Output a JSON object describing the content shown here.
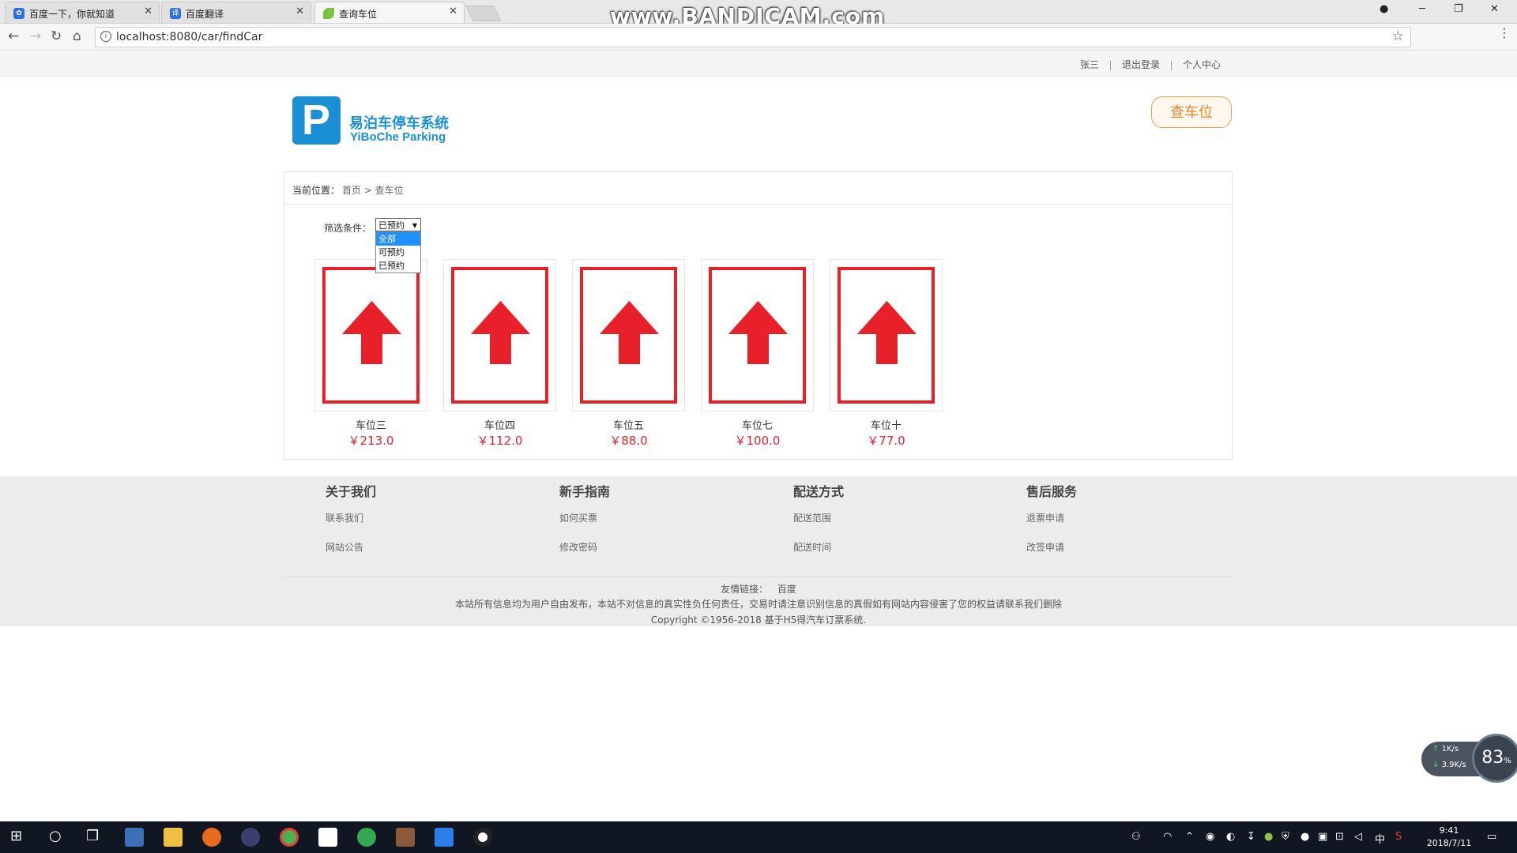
{
  "browser": {
    "tabs": [
      {
        "title": "百度一下，你就知道",
        "icon": "baidu-paw-icon",
        "active": false
      },
      {
        "title": "百度翻译",
        "icon": "baidu-translate-icon",
        "active": false
      },
      {
        "title": "查询车位",
        "icon": "leaf-icon",
        "active": true
      }
    ],
    "watermark": "www.BANDICAM.com",
    "url": "localhost:8080/car/findCar"
  },
  "userbar": {
    "username": "张三",
    "logout": "退出登录",
    "profile": "个人中心"
  },
  "header": {
    "logo_letter": "P",
    "logo_cn": "易泊车停车系统",
    "logo_en": "YiBoChe  Parking",
    "query_button": "查车位"
  },
  "breadcrumb": {
    "label": "当前位置：",
    "path": "首页 > 查车位"
  },
  "filter": {
    "label": "筛选条件：",
    "selected": "已预约",
    "options": [
      "全部",
      "可预约",
      "已预约"
    ],
    "highlighted": "全部"
  },
  "spaces": [
    {
      "name": "车位三",
      "price": "￥213.0"
    },
    {
      "name": "车位四",
      "price": "￥112.0"
    },
    {
      "name": "车位五",
      "price": "￥88.0"
    },
    {
      "name": "车位七",
      "price": "￥100.0"
    },
    {
      "name": "车位十",
      "price": "￥77.0"
    }
  ],
  "footer": {
    "columns": [
      {
        "title": "关于我们",
        "links": [
          "联系我们",
          "网站公告"
        ]
      },
      {
        "title": "新手指南",
        "links": [
          "如何买票",
          "修改密码"
        ]
      },
      {
        "title": "配送方式",
        "links": [
          "配送范围",
          "配送时间"
        ]
      },
      {
        "title": "售后服务",
        "links": [
          "退票申请",
          "改签申请"
        ]
      }
    ],
    "friend_links_label": "友情链接：",
    "friend_link": "百度",
    "disclaimer": "本站所有信息均为用户自由发布，本站不对信息的真实性负任何责任，交易时请注意识别信息的真假如有网站内容侵害了您的权益请联系我们删除",
    "copyright": "Copyright ©1956-2018 基于H5得汽车订票系统."
  },
  "netspeed": {
    "up": "1K/s",
    "down": "3.9K/s",
    "percent": "83",
    "percent_unit": "%"
  },
  "taskbar": {
    "time": "9:41",
    "date": "2018/7/11",
    "ime": "中"
  },
  "colors": {
    "accent_blue": "#1b8fd4",
    "parking_red": "#e8202a",
    "query_orange": "#e8852a"
  }
}
